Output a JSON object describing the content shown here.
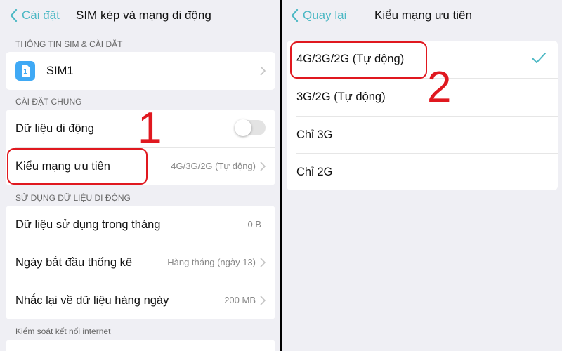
{
  "left": {
    "back_label": "Cài đặt",
    "title": "SIM kép và mạng di động",
    "section_sim": "THÔNG TIN SIM & CÀI ĐẶT",
    "sim_label": "SIM1",
    "sim_icon_number": "1",
    "section_general": "CÀI ĐẶT CHUNG",
    "mobile_data_label": "Dữ liệu di động",
    "mobile_data_on": false,
    "network_type_label": "Kiểu mạng ưu tiên",
    "network_type_value": "4G/3G/2G (Tự động)",
    "section_usage": "SỬ DỤNG DỮ LIỆU DI ĐỘNG",
    "usage_month_label": "Dữ liệu sử dụng trong tháng",
    "usage_month_value": "0 B",
    "start_date_label": "Ngày bắt đầu thống kê",
    "start_date_value": "Hàng tháng (ngày 13)",
    "daily_reminder_label": "Nhắc lại về dữ liệu hàng ngày",
    "daily_reminder_value": "200 MB",
    "section_internet": "Kiểm soát kết nối internet",
    "annotation": "1"
  },
  "right": {
    "back_label": "Quay lại",
    "title": "Kiểu mạng ưu tiên",
    "options": [
      {
        "label": "4G/3G/2G (Tự động)",
        "selected": true
      },
      {
        "label": "3G/2G (Tự động)",
        "selected": false
      },
      {
        "label": "Chỉ 3G",
        "selected": false
      },
      {
        "label": "Chỉ 2G",
        "selected": false
      }
    ],
    "annotation": "2"
  },
  "colors": {
    "accent": "#4cb8c4",
    "annotation_red": "#e0181f",
    "background": "#efeff4"
  },
  "icons": [
    "chevron-left-icon",
    "sim-card-icon",
    "chevron-right-icon",
    "checkmark-icon",
    "toggle-switch"
  ]
}
